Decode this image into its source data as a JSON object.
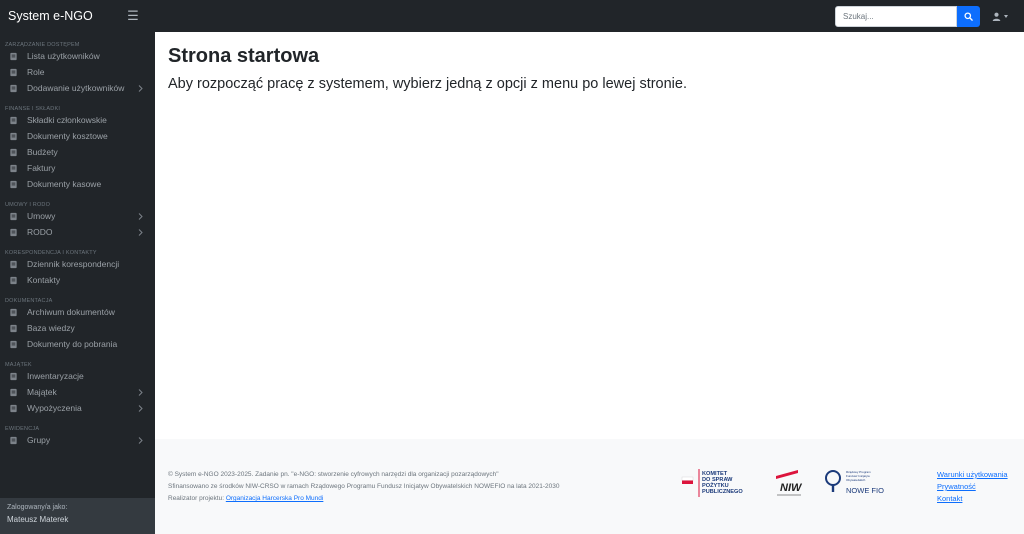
{
  "topbar": {
    "brand": "System e-NGO",
    "menu_toggle_icon": "hamburger-icon",
    "search": {
      "placeholder": "Szukaj...",
      "value": "",
      "button_icon": "search-icon"
    },
    "user_icon": "user-icon"
  },
  "colors": {
    "navbar": "#212529",
    "sidebar": "#212529",
    "sidebar_footer": "#343a40",
    "accent": "#0d6efd",
    "footer_bg": "#f8f9fa",
    "muted": "#6c757d"
  },
  "sidebar": {
    "sections": [
      {
        "heading": "ZARZĄDZANIE DOSTĘPEM",
        "items": [
          {
            "label": "Lista użytkowników",
            "icon": "users-icon",
            "submenu": false
          },
          {
            "label": "Role",
            "icon": "id-card-icon",
            "submenu": false
          },
          {
            "label": "Dodawanie użytkowników",
            "icon": "user-plus-icon",
            "submenu": true
          }
        ]
      },
      {
        "heading": "FINANSE I SKŁADKI",
        "items": [
          {
            "label": "Składki członkowskie",
            "icon": "coins-icon",
            "submenu": false
          },
          {
            "label": "Dokumenty kosztowe",
            "icon": "document-icon",
            "submenu": false
          },
          {
            "label": "Budżety",
            "icon": "budget-icon",
            "submenu": false
          },
          {
            "label": "Faktury",
            "icon": "invoice-icon",
            "submenu": false
          },
          {
            "label": "Dokumenty kasowe",
            "icon": "cash-register-icon",
            "submenu": false
          }
        ]
      },
      {
        "heading": "UMOWY I RODO",
        "items": [
          {
            "label": "Umowy",
            "icon": "contract-icon",
            "submenu": true
          },
          {
            "label": "RODO",
            "icon": "folder-lock-icon",
            "submenu": true
          }
        ]
      },
      {
        "heading": "KORESPONDENCJA I KONTAKTY",
        "items": [
          {
            "label": "Dziennik korespondencji",
            "icon": "book-icon",
            "submenu": false
          },
          {
            "label": "Kontakty",
            "icon": "address-book-icon",
            "submenu": false
          }
        ]
      },
      {
        "heading": "DOKUMENTACJA",
        "items": [
          {
            "label": "Archiwum dokumentów",
            "icon": "archive-icon",
            "submenu": false
          },
          {
            "label": "Baza wiedzy",
            "icon": "open-book-icon",
            "submenu": false
          },
          {
            "label": "Dokumenty do pobrania",
            "icon": "download-icon",
            "submenu": false
          }
        ]
      },
      {
        "heading": "MAJĄTEK",
        "items": [
          {
            "label": "Inwentaryzacje",
            "icon": "clipboard-list-icon",
            "submenu": false
          },
          {
            "label": "Majątek",
            "icon": "hand-holding-icon",
            "submenu": true
          },
          {
            "label": "Wypożyczenia",
            "icon": "boxes-icon",
            "submenu": true
          }
        ]
      },
      {
        "heading": "EWIDENCJA",
        "items": [
          {
            "label": "Grupy",
            "icon": "group-icon",
            "submenu": true
          }
        ]
      }
    ],
    "footer": {
      "caption": "Zalogowany/a jako:",
      "user": "Mateusz Materek"
    }
  },
  "main": {
    "title": "Strona startowa",
    "lead": "Aby rozpocząć pracę z systemem, wybierz jedną z opcji z menu po lewej stronie."
  },
  "footer": {
    "copyright": "© System e-NGO 2023-2025. Zadanie pn. \"e-NGO: stworzenie cyfrowych narzędzi dla organizacji pozarządowych\"",
    "funding": "Sfinansowano ze środków NIW-CRSO w ramach Rządowego Programu Fundusz Inicjatyw Obywatelskich NOWEFIO na lata 2021-2030",
    "realizer_prefix": "Realizator projektu:",
    "realizer_link": "Organizacja Harcerska Pro Mundi",
    "logos": {
      "komitet": [
        "KOMITET",
        "DO SPRAW",
        "POŻYTKU",
        "PUBLICZNEGO"
      ],
      "niw": "NIW",
      "nowefio_caption": [
        "Rządowy Program",
        "Fundusz Inicjatyw",
        "Obywatelskich"
      ],
      "nowefio": "NOWE FIO"
    },
    "links": [
      "Warunki użytkowania",
      "Prywatność",
      "Kontakt"
    ]
  }
}
